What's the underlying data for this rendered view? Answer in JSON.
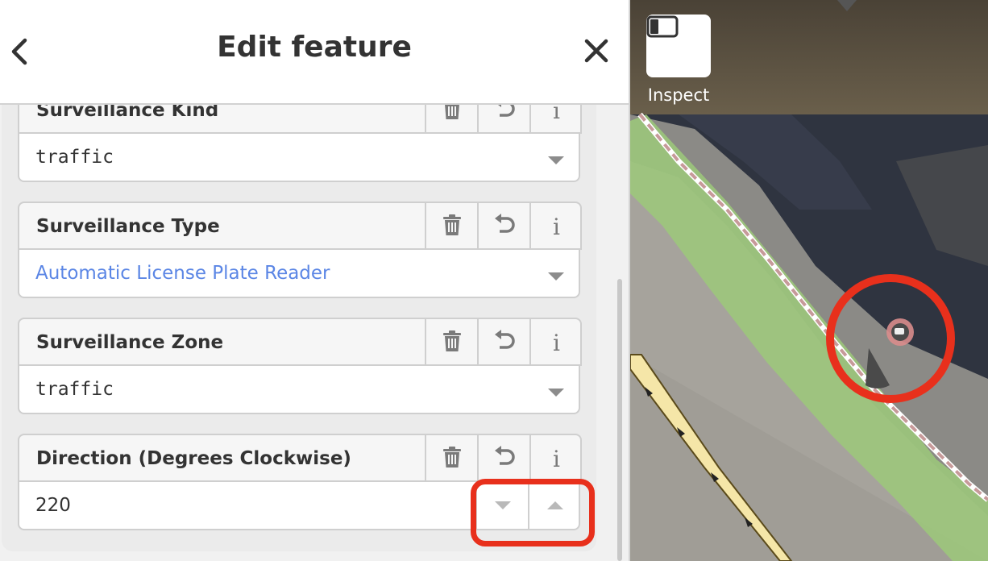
{
  "header": {
    "title": "Edit feature"
  },
  "fields": [
    {
      "label": "Surveillance Kind",
      "value": "traffic",
      "value_style": "mono"
    },
    {
      "label": "Surveillance Type",
      "value": "Automatic License Plate Reader",
      "value_style": "preset"
    },
    {
      "label": "Surveillance Zone",
      "value": "traffic",
      "value_style": "mono"
    },
    {
      "label": "Direction (Degrees Clockwise)",
      "value": "220",
      "value_style": "number"
    }
  ],
  "map": {
    "inspect_label": "Inspect"
  },
  "colors": {
    "highlight_red": "#e8301c",
    "preset_blue": "#5b86e5",
    "path_green": "#9cc97a",
    "road_yellow": "#f5e6a8"
  },
  "icons": [
    "back-chevron-icon",
    "close-icon",
    "trash-icon",
    "undo-icon",
    "info-icon",
    "chevron-down-icon",
    "chevron-up-icon",
    "sidebar-toggle-icon",
    "camera-icon"
  ]
}
